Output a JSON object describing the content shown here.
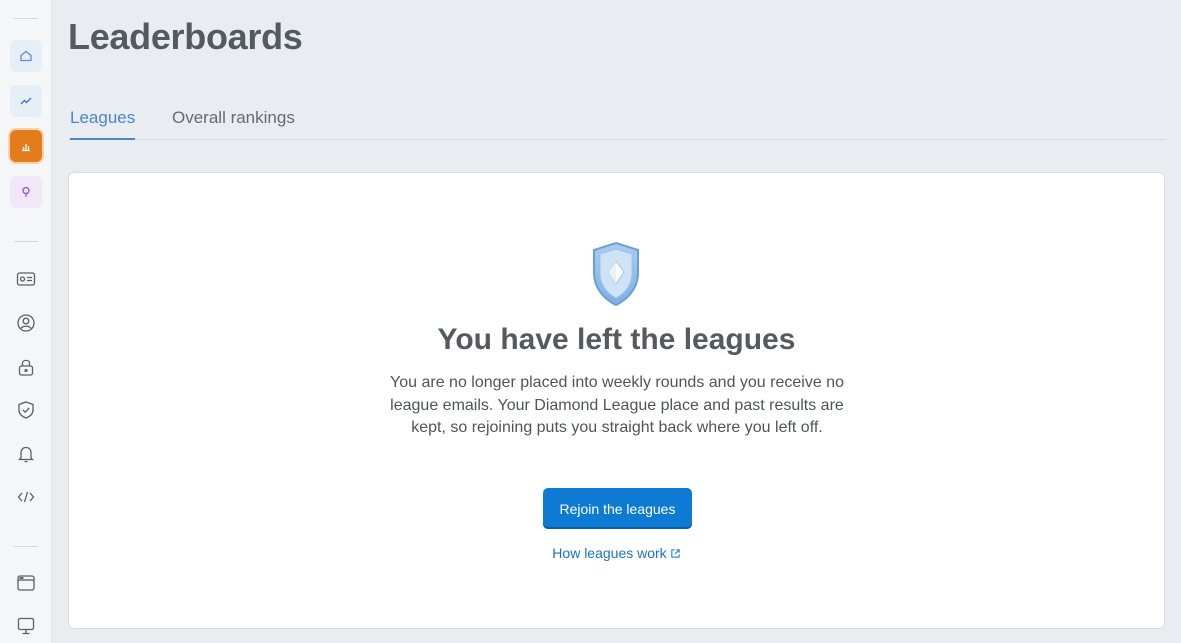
{
  "sidebar": {
    "items": [
      {
        "name": "home-icon",
        "color": "#5a8fd8",
        "bg": "#e6eef8"
      },
      {
        "name": "trend-icon",
        "color": "#3b7ac8",
        "bg": "#e6eef8"
      },
      {
        "name": "bar-chart-icon",
        "color": "#ffffff",
        "bg": "#e47c1b",
        "active": true
      },
      {
        "name": "lightbulb-icon",
        "color": "#9a4fd3",
        "bg": "#f0e8f8"
      },
      {
        "name": "id-card-icon"
      },
      {
        "name": "user-circle-icon"
      },
      {
        "name": "lock-icon"
      },
      {
        "name": "shield-check-icon"
      },
      {
        "name": "bell-icon"
      },
      {
        "name": "code-icon"
      },
      {
        "name": "browser-window-icon"
      },
      {
        "name": "monitor-icon"
      }
    ]
  },
  "header": {
    "title": "Leaderboards"
  },
  "tabs": [
    {
      "label": "Leagues",
      "active": true
    },
    {
      "label": "Overall rankings",
      "active": false
    }
  ],
  "card": {
    "title": "You have left the leagues",
    "body": "You are no longer placed into weekly rounds and you receive no league emails. Your Diamond League place and past results are kept, so rejoining puts you straight back where you left off.",
    "button_label": "Rejoin the leagues",
    "link_label": "How leagues work",
    "icon": "diamond-shield-icon"
  },
  "colors": {
    "accent": "#0d7ad3",
    "active_tab": "#4b86c6",
    "active_nav": "#e47c1b"
  }
}
